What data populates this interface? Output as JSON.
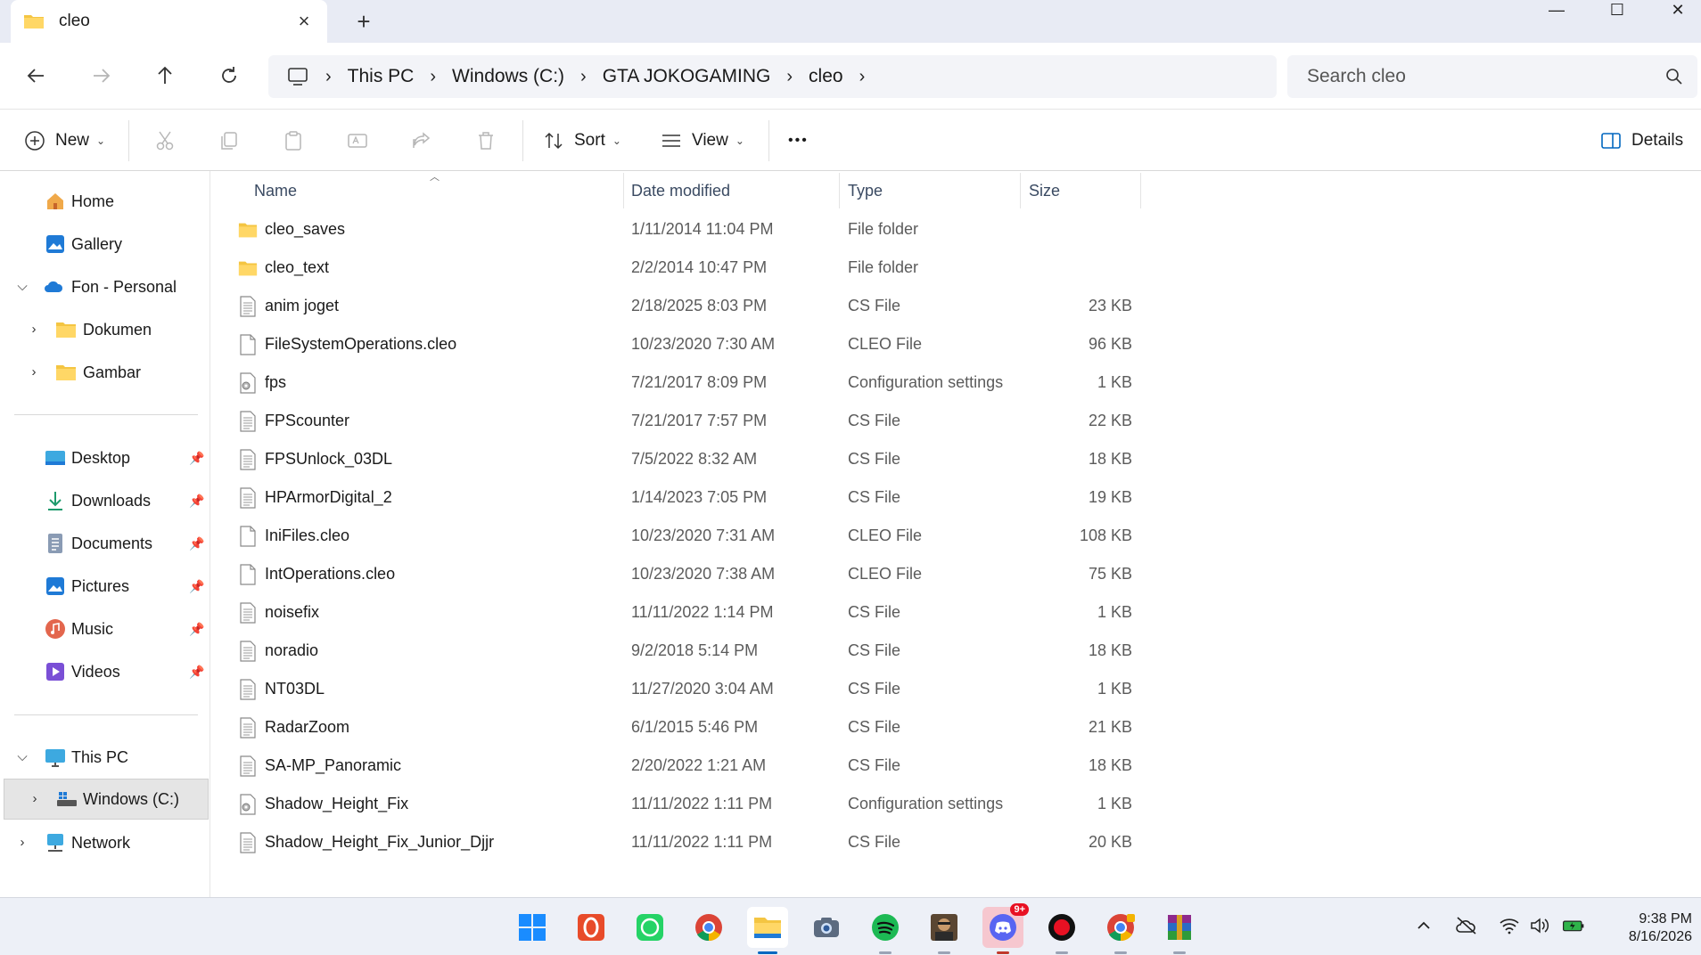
{
  "window": {
    "tab_title": "cleo",
    "close_tab": "×",
    "new_tab": "+",
    "minimize": "—",
    "maximize": "☐",
    "close": "✕"
  },
  "breadcrumb": [
    "This PC",
    "Windows (C:)",
    "GTA JOKOGAMING",
    "cleo"
  ],
  "search": {
    "placeholder": "Search cleo"
  },
  "toolbar": {
    "new_label": "New",
    "sort_label": "Sort",
    "view_label": "View",
    "more_label": "•••",
    "details_label": "Details"
  },
  "sidebar": {
    "home": "Home",
    "gallery": "Gallery",
    "onedrive": "Fon - Personal",
    "dokumen": "Dokumen",
    "gambar": "Gambar",
    "desktop": "Desktop",
    "downloads": "Downloads",
    "documents": "Documents",
    "pictures": "Pictures",
    "music": "Music",
    "videos": "Videos",
    "this_pc": "This PC",
    "windows_c": "Windows (C:)",
    "network": "Network"
  },
  "columns": {
    "name": "Name",
    "date": "Date modified",
    "type": "Type",
    "size": "Size"
  },
  "files": [
    {
      "name": "cleo_saves",
      "date": "1/11/2014 11:04 PM",
      "type": "File folder",
      "size": "",
      "kind": "folder"
    },
    {
      "name": "cleo_text",
      "date": "2/2/2014 10:47 PM",
      "type": "File folder",
      "size": "",
      "kind": "folder"
    },
    {
      "name": "anim joget",
      "date": "2/18/2025 8:03 PM",
      "type": "CS File",
      "size": "23 KB",
      "kind": "text"
    },
    {
      "name": "FileSystemOperations.cleo",
      "date": "10/23/2020 7:30 AM",
      "type": "CLEO File",
      "size": "96 KB",
      "kind": "blank"
    },
    {
      "name": "fps",
      "date": "7/21/2017 8:09 PM",
      "type": "Configuration settings",
      "size": "1 KB",
      "kind": "config"
    },
    {
      "name": "FPScounter",
      "date": "7/21/2017 7:57 PM",
      "type": "CS File",
      "size": "22 KB",
      "kind": "text"
    },
    {
      "name": "FPSUnlock_03DL",
      "date": "7/5/2022 8:32 AM",
      "type": "CS File",
      "size": "18 KB",
      "kind": "text"
    },
    {
      "name": "HPArmorDigital_2",
      "date": "1/14/2023 7:05 PM",
      "type": "CS File",
      "size": "19 KB",
      "kind": "text"
    },
    {
      "name": "IniFiles.cleo",
      "date": "10/23/2020 7:31 AM",
      "type": "CLEO File",
      "size": "108 KB",
      "kind": "blank"
    },
    {
      "name": "IntOperations.cleo",
      "date": "10/23/2020 7:38 AM",
      "type": "CLEO File",
      "size": "75 KB",
      "kind": "blank"
    },
    {
      "name": "noisefix",
      "date": "11/11/2022 1:14 PM",
      "type": "CS File",
      "size": "1 KB",
      "kind": "text"
    },
    {
      "name": "noradio",
      "date": "9/2/2018 5:14 PM",
      "type": "CS File",
      "size": "18 KB",
      "kind": "text"
    },
    {
      "name": "NT03DL",
      "date": "11/27/2020 3:04 AM",
      "type": "CS File",
      "size": "1 KB",
      "kind": "text"
    },
    {
      "name": "RadarZoom",
      "date": "6/1/2015 5:46 PM",
      "type": "CS File",
      "size": "21 KB",
      "kind": "text"
    },
    {
      "name": "SA-MP_Panoramic",
      "date": "2/20/2022 1:21 AM",
      "type": "CS File",
      "size": "18 KB",
      "kind": "text"
    },
    {
      "name": "Shadow_Height_Fix",
      "date": "11/11/2022 1:11 PM",
      "type": "Configuration settings",
      "size": "1 KB",
      "kind": "config"
    },
    {
      "name": "Shadow_Height_Fix_Junior_Djjr",
      "date": "11/11/2022 1:11 PM",
      "type": "CS File",
      "size": "20 KB",
      "kind": "text"
    }
  ],
  "taskbar": {
    "apps": [
      "start-icon",
      "opera-icon",
      "whatsapp-icon",
      "chrome-icon",
      "file-explorer-icon",
      "camera-icon",
      "spotify-icon",
      "game-icon",
      "discord-icon",
      "recorder-icon",
      "chrome-dev-icon",
      "winrar-icon"
    ],
    "discord_badge": "9+",
    "time": "9:38 PM",
    "date": "8/16/2026"
  },
  "colors": {
    "accent": "#0067c0",
    "folder": "#f4c542",
    "selected": "#e5e5e5"
  }
}
